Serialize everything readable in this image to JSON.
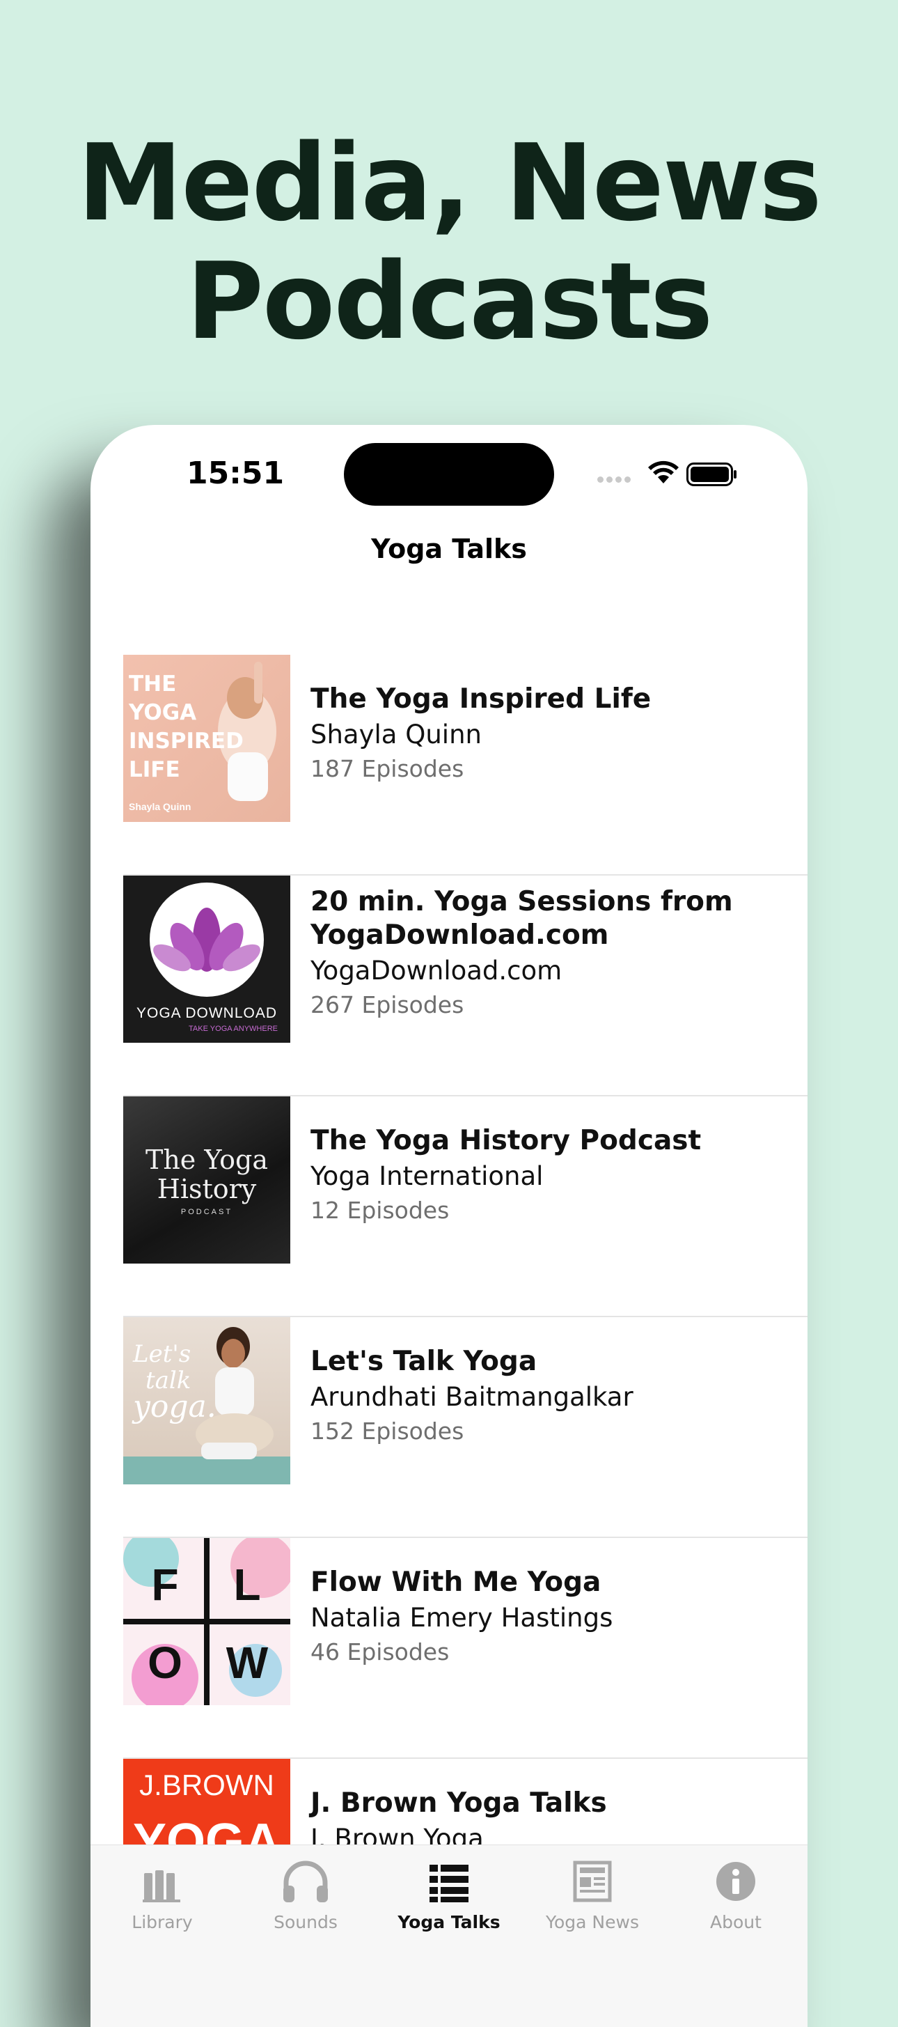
{
  "headline": {
    "line1": "Media, News",
    "line2": "Podcasts"
  },
  "status_bar": {
    "time": "15:51"
  },
  "nav": {
    "title": "Yoga Talks"
  },
  "podcasts": [
    {
      "title": "The Yoga Inspired Life",
      "author": "Shayla Quinn",
      "episodes": "187 Episodes",
      "art_text": [
        "THE",
        "YOGA",
        "INSPIRED",
        "LIFE"
      ],
      "art_caption": "Shayla Quinn"
    },
    {
      "title": "20 min. Yoga Sessions from YogaDownload.com",
      "author": "YogaDownload.com",
      "episodes": "267 Episodes",
      "art_text": [
        "YOGA DOWNLOAD"
      ],
      "art_caption": "TAKE YOGA ANYWHERE"
    },
    {
      "title": "The Yoga History Podcast",
      "author": "Yoga International",
      "episodes": "12 Episodes",
      "art_text": [
        "The Yoga",
        "History"
      ],
      "art_caption": "PODCAST"
    },
    {
      "title": "Let's Talk Yoga",
      "author": "Arundhati Baitmangalkar",
      "episodes": "152 Episodes",
      "art_text": [
        "Let's",
        "talk",
        "yoga."
      ],
      "art_caption": ""
    },
    {
      "title": "Flow With Me Yoga",
      "author": "Natalia Emery Hastings",
      "episodes": "46 Episodes",
      "art_text": [
        "F",
        "L",
        "O",
        "W"
      ],
      "art_caption": ""
    },
    {
      "title": "J. Brown Yoga Talks",
      "author": "J. Brown Yoga",
      "episodes": "",
      "art_text": [
        "J.BROWN",
        "YOGA"
      ],
      "art_caption": ""
    }
  ],
  "tabs": [
    {
      "label": "Library",
      "icon": "library-icon",
      "active": false
    },
    {
      "label": "Sounds",
      "icon": "headphones-icon",
      "active": false
    },
    {
      "label": "Yoga Talks",
      "icon": "list-icon",
      "active": true
    },
    {
      "label": "Yoga News",
      "icon": "newspaper-icon",
      "active": false
    },
    {
      "label": "About",
      "icon": "info-icon",
      "active": false
    }
  ]
}
